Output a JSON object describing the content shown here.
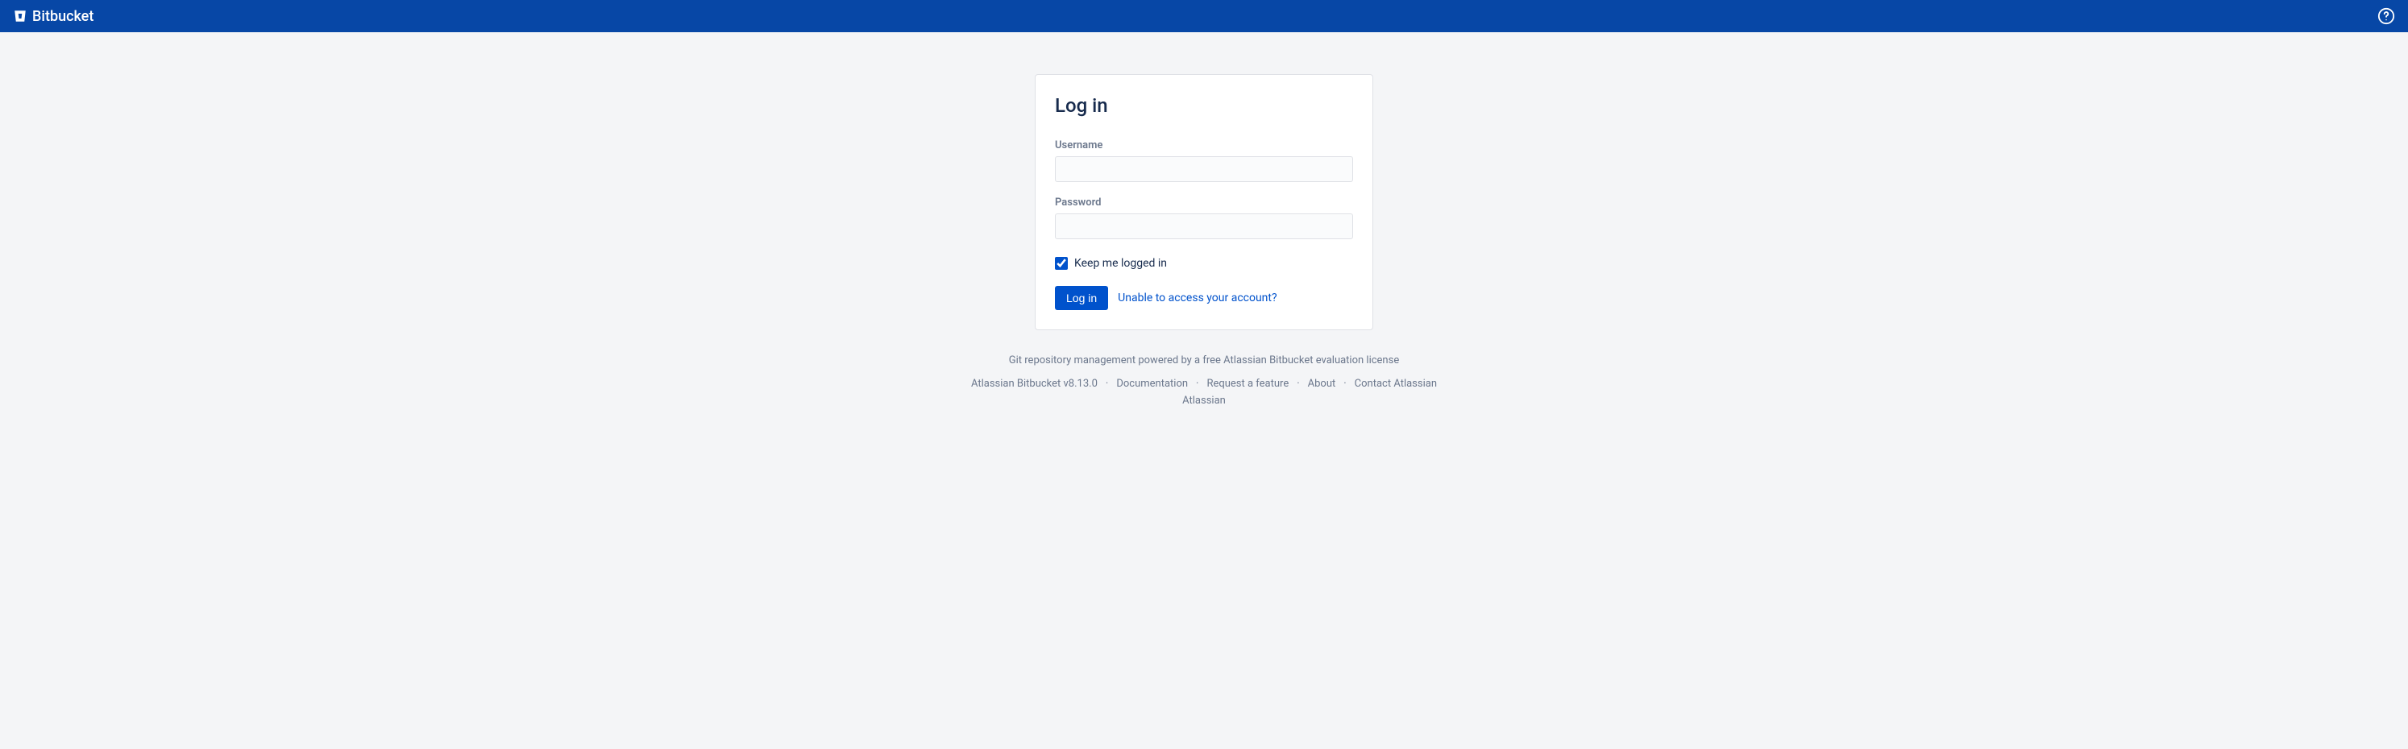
{
  "header": {
    "product_name": "Bitbucket"
  },
  "login": {
    "title": "Log in",
    "username_label": "Username",
    "username_value": "",
    "password_label": "Password",
    "password_value": "",
    "keep_logged_in_label": "Keep me logged in",
    "keep_logged_in_checked": true,
    "submit_label": "Log in",
    "help_link_label": "Unable to access your account?"
  },
  "footer": {
    "tagline": "Git repository management powered by a free Atlassian Bitbucket evaluation license",
    "version_label": "Atlassian Bitbucket v8.13.0",
    "links": {
      "documentation": "Documentation",
      "request_feature": "Request a feature",
      "about": "About",
      "contact": "Contact Atlassian",
      "atlassian": "Atlassian"
    }
  }
}
